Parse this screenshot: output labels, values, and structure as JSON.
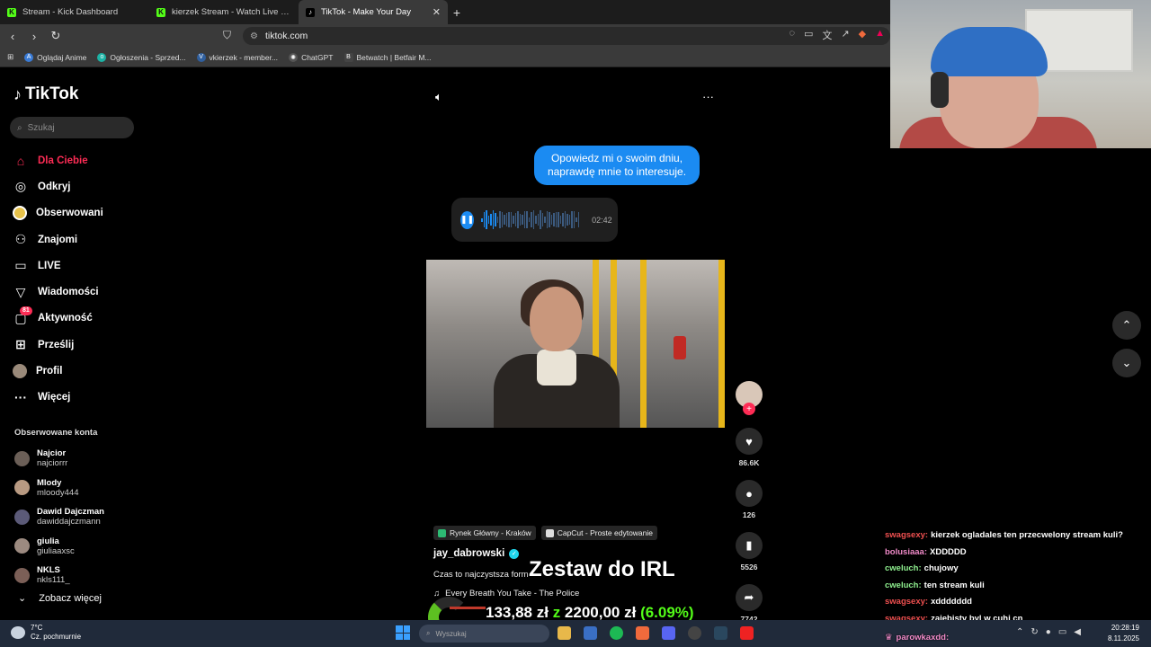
{
  "tabs": [
    {
      "label": "Stream - Kick Dashboard",
      "icon": "kick-icon",
      "active": false
    },
    {
      "label": "kierzek Stream - Watch Live on Kick",
      "icon": "kick-icon",
      "active": false
    },
    {
      "label": "TikTok - Make Your Day",
      "icon": "tiktok-icon",
      "active": true
    }
  ],
  "address": {
    "url": "tiktok.com"
  },
  "bookmarks": [
    {
      "label": "Oglądaj Anime"
    },
    {
      "label": "Ogłoszenia - Sprzed..."
    },
    {
      "label": "vkierzek - member..."
    },
    {
      "label": "ChatGPT"
    },
    {
      "label": "Betwatch | Betfair M..."
    }
  ],
  "tiktok": {
    "logo": "TikTok",
    "search_placeholder": "Szukaj",
    "nav": [
      {
        "label": "Dla Ciebie",
        "icon": "home-icon",
        "active": true
      },
      {
        "label": "Odkryj",
        "icon": "compass-icon"
      },
      {
        "label": "Obserwowani",
        "icon": "following-icon"
      },
      {
        "label": "Znajomi",
        "icon": "friends-icon"
      },
      {
        "label": "LIVE",
        "icon": "live-icon"
      },
      {
        "label": "Wiadomości",
        "icon": "messages-icon"
      },
      {
        "label": "Aktywność",
        "icon": "activity-icon",
        "badge": "81"
      },
      {
        "label": "Prześlij",
        "icon": "upload-icon"
      },
      {
        "label": "Profil",
        "icon": "profile-icon"
      },
      {
        "label": "Więcej",
        "icon": "more-icon"
      }
    ],
    "followed_title": "Obserwowane konta",
    "followed": [
      {
        "name": "Najcior",
        "user": "najciorrr"
      },
      {
        "name": "Mlody",
        "user": "mloody444"
      },
      {
        "name": "Dawid Dajczman",
        "user": "dawiddajczmann"
      },
      {
        "name": "giulia",
        "user": "giuliaaxsc"
      },
      {
        "name": "NKLS",
        "user": "nkls111_"
      }
    ],
    "see_more": "Zobacz więcej"
  },
  "video": {
    "bubble_text": "Opowiedz mi o swoim dniu, naprawdę mnie to interesuje.",
    "voice_time": "02:42",
    "tags": [
      {
        "label": "Rynek Główny - Kraków"
      },
      {
        "label": "CapCut - Proste edytowanie"
      }
    ],
    "author": "jay_dabrowski",
    "description": "Czas to najczystsza form",
    "music": "Every Breath You Take - The Police",
    "likes": "86.6K",
    "comments": "126",
    "saves": "5526",
    "shares": "7742"
  },
  "overlay": {
    "irl_title": "Zestaw do IRL",
    "donation_current": "133,88 zł",
    "donation_sep": "z",
    "donation_goal": "2200,00 zł",
    "donation_pct": "(6.09%)"
  },
  "chat": [
    {
      "user": "swagsexy:",
      "msg": "kierzek ogladales ten przecwelony stream kuli?",
      "color": "red"
    },
    {
      "user": "bolusiaaa:",
      "msg": "XDDDDD",
      "color": "pink"
    },
    {
      "user": "cweluch:",
      "msg": "chujowy",
      "color": "green"
    },
    {
      "user": "cweluch:",
      "msg": "ten stream kuli",
      "color": "green"
    },
    {
      "user": "swagsexy:",
      "msg": "xddddddd",
      "color": "red"
    },
    {
      "user": "swagsexy:",
      "msg": "zajebisty byl w cuhj cn",
      "color": "red"
    }
  ],
  "donor": "parowkaxdd:",
  "taskbar": {
    "temperature": "7°C",
    "weather": "Cz. pochmurnie",
    "search_placeholder": "Wyszukaj",
    "time": "20:28:19",
    "date": "8.11.2025"
  },
  "colors": {
    "accent": "#fe2c55",
    "kick": "#53fc18",
    "bubble": "#1b8bf2"
  }
}
